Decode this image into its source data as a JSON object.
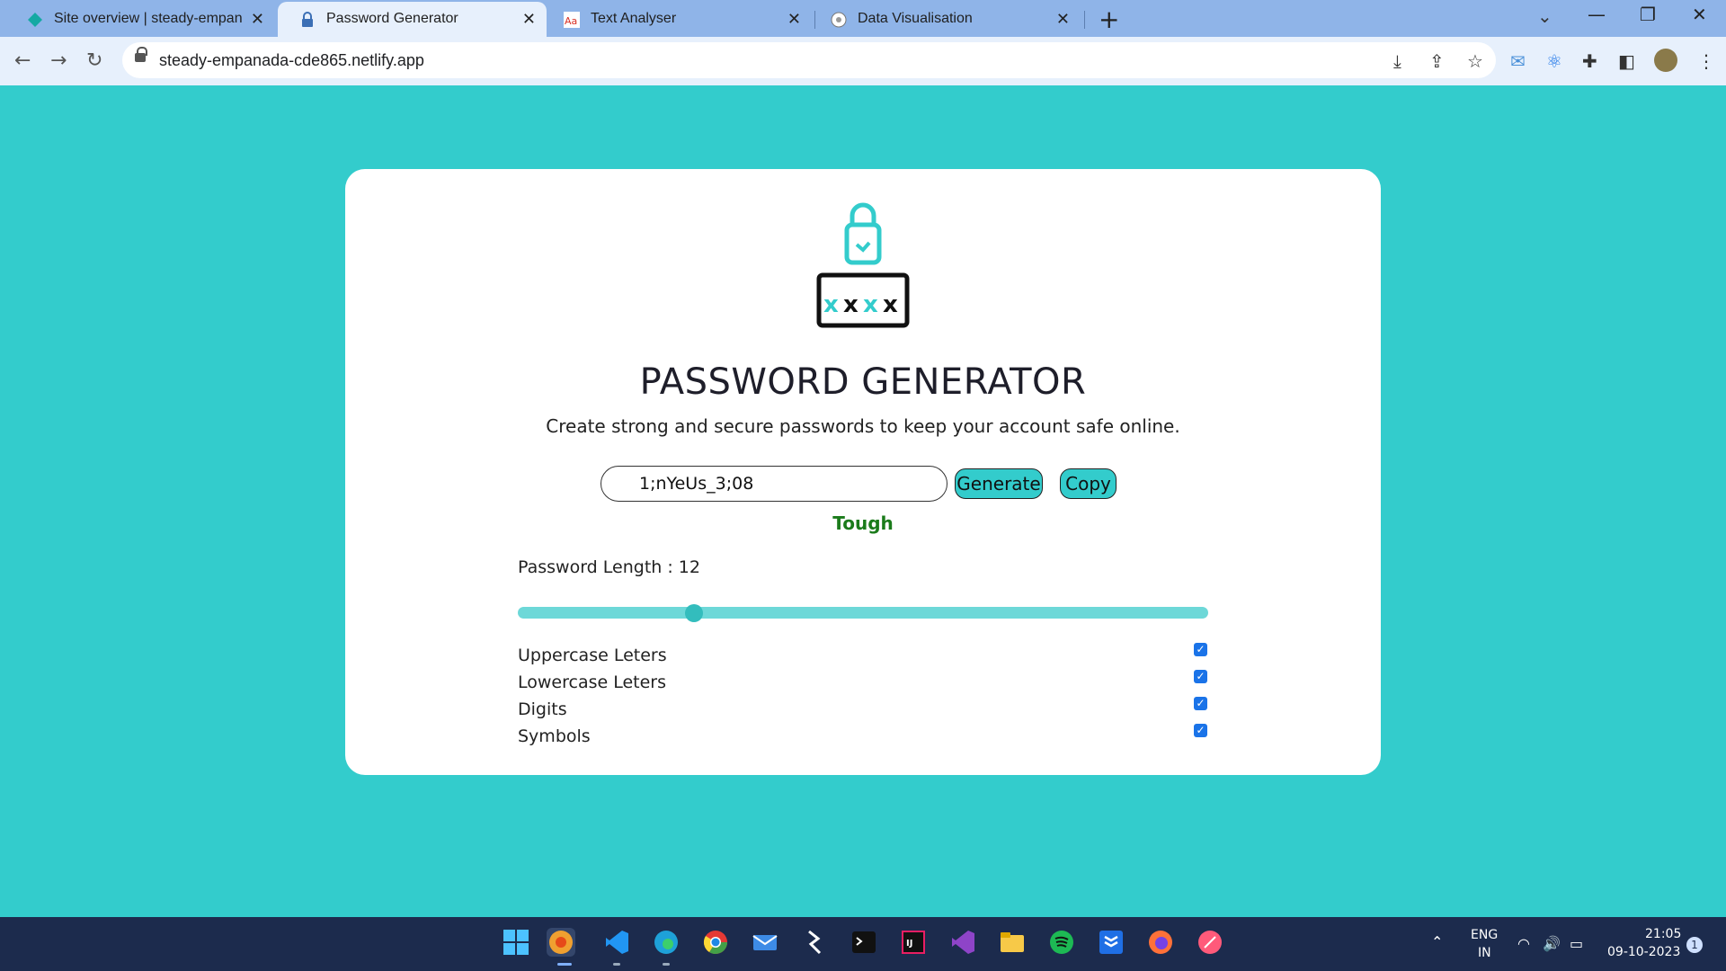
{
  "browser": {
    "tabs": [
      {
        "title": "Site overview | steady-empanada",
        "active": false,
        "icon": "netlify-icon"
      },
      {
        "title": "Password Generator",
        "active": true,
        "icon": "padlock-icon"
      },
      {
        "title": "Text Analyser",
        "active": false,
        "icon": "text-analyser-icon"
      },
      {
        "title": "Data Visualisation",
        "active": false,
        "icon": "globe-icon"
      }
    ],
    "url": "steady-empanada-cde865.netlify.app"
  },
  "page": {
    "title": "PASSWORD GENERATOR",
    "subtitle": "Create strong and secure passwords to keep your account safe online.",
    "password_value": "1;nYeUs_3;08",
    "generate_label": "Generate",
    "copy_label": "Copy",
    "strength": "Tough",
    "length_label": "Password Length : 12",
    "length_value": 12,
    "slider_fraction": 0.255,
    "options": [
      {
        "label": "Uppercase Leters",
        "checked": true
      },
      {
        "label": "Lowercase Leters",
        "checked": true
      },
      {
        "label": "Digits",
        "checked": true
      },
      {
        "label": "Symbols",
        "checked": true
      }
    ],
    "logo_text": "XXXX"
  },
  "colors": {
    "background": "#33cccc",
    "accent": "#33cccc",
    "strength": "#1b7b1b",
    "checkbox": "#1a73e8"
  },
  "taskbar": {
    "apps": [
      "windows-start-icon",
      "chrome-canary-icon",
      "vscode-icon",
      "edge-icon",
      "chrome-icon",
      "mail-icon",
      "sublime-icon",
      "terminal-icon",
      "intellij-icon",
      "visual-studio-icon",
      "file-explorer-icon",
      "spotify-icon",
      "dropbox-icon",
      "firefox-icon",
      "app-icon"
    ],
    "lang_line1": "ENG",
    "lang_line2": "IN",
    "time": "21:05",
    "date": "09-10-2023",
    "notifications": "1"
  }
}
